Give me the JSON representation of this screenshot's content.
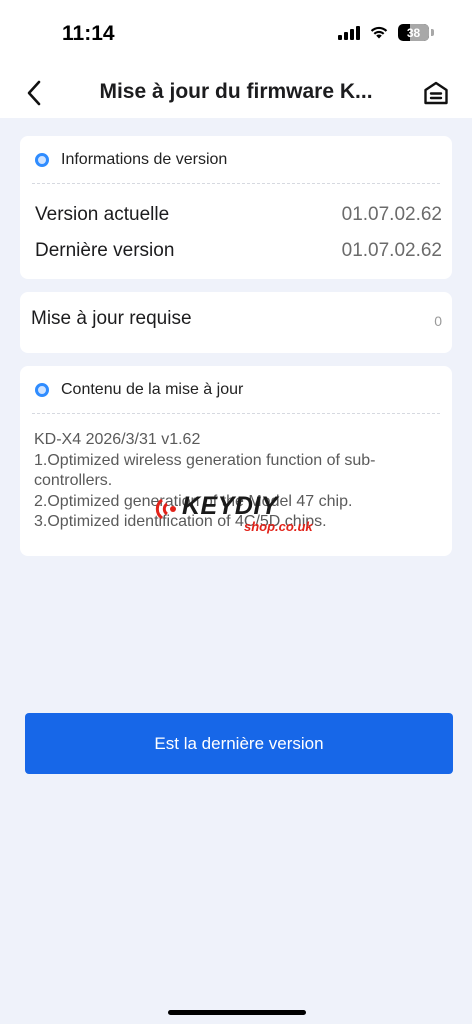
{
  "status": {
    "time": "11:14",
    "battery": "38"
  },
  "nav": {
    "title": "Mise à jour du firmware K..."
  },
  "version_card": {
    "header": "Informations de version",
    "current_label": "Version actuelle",
    "current_value": "01.07.02.62",
    "latest_label": "Dernière version",
    "latest_value": "01.07.02.62"
  },
  "required_card": {
    "label": "Mise à jour requise",
    "count": "0"
  },
  "content_card": {
    "header": "Contenu de la mise à jour",
    "lines": [
      "KD-X4 2026/3/31 v1.62",
      "1.Optimized wireless generation function of sub-",
      "controllers.",
      "2.Optimized generation of the Model 47 chip.",
      "3.Optimized identification of 4C/5D chips."
    ]
  },
  "watermark": {
    "brand": "KEYDIY",
    "shop": "shop.co.uk"
  },
  "actions": {
    "primary_label": "Est la dernière version"
  },
  "colors": {
    "accent": "#1767e8",
    "background": "#eff2fa",
    "dot": "#2f8cff"
  }
}
